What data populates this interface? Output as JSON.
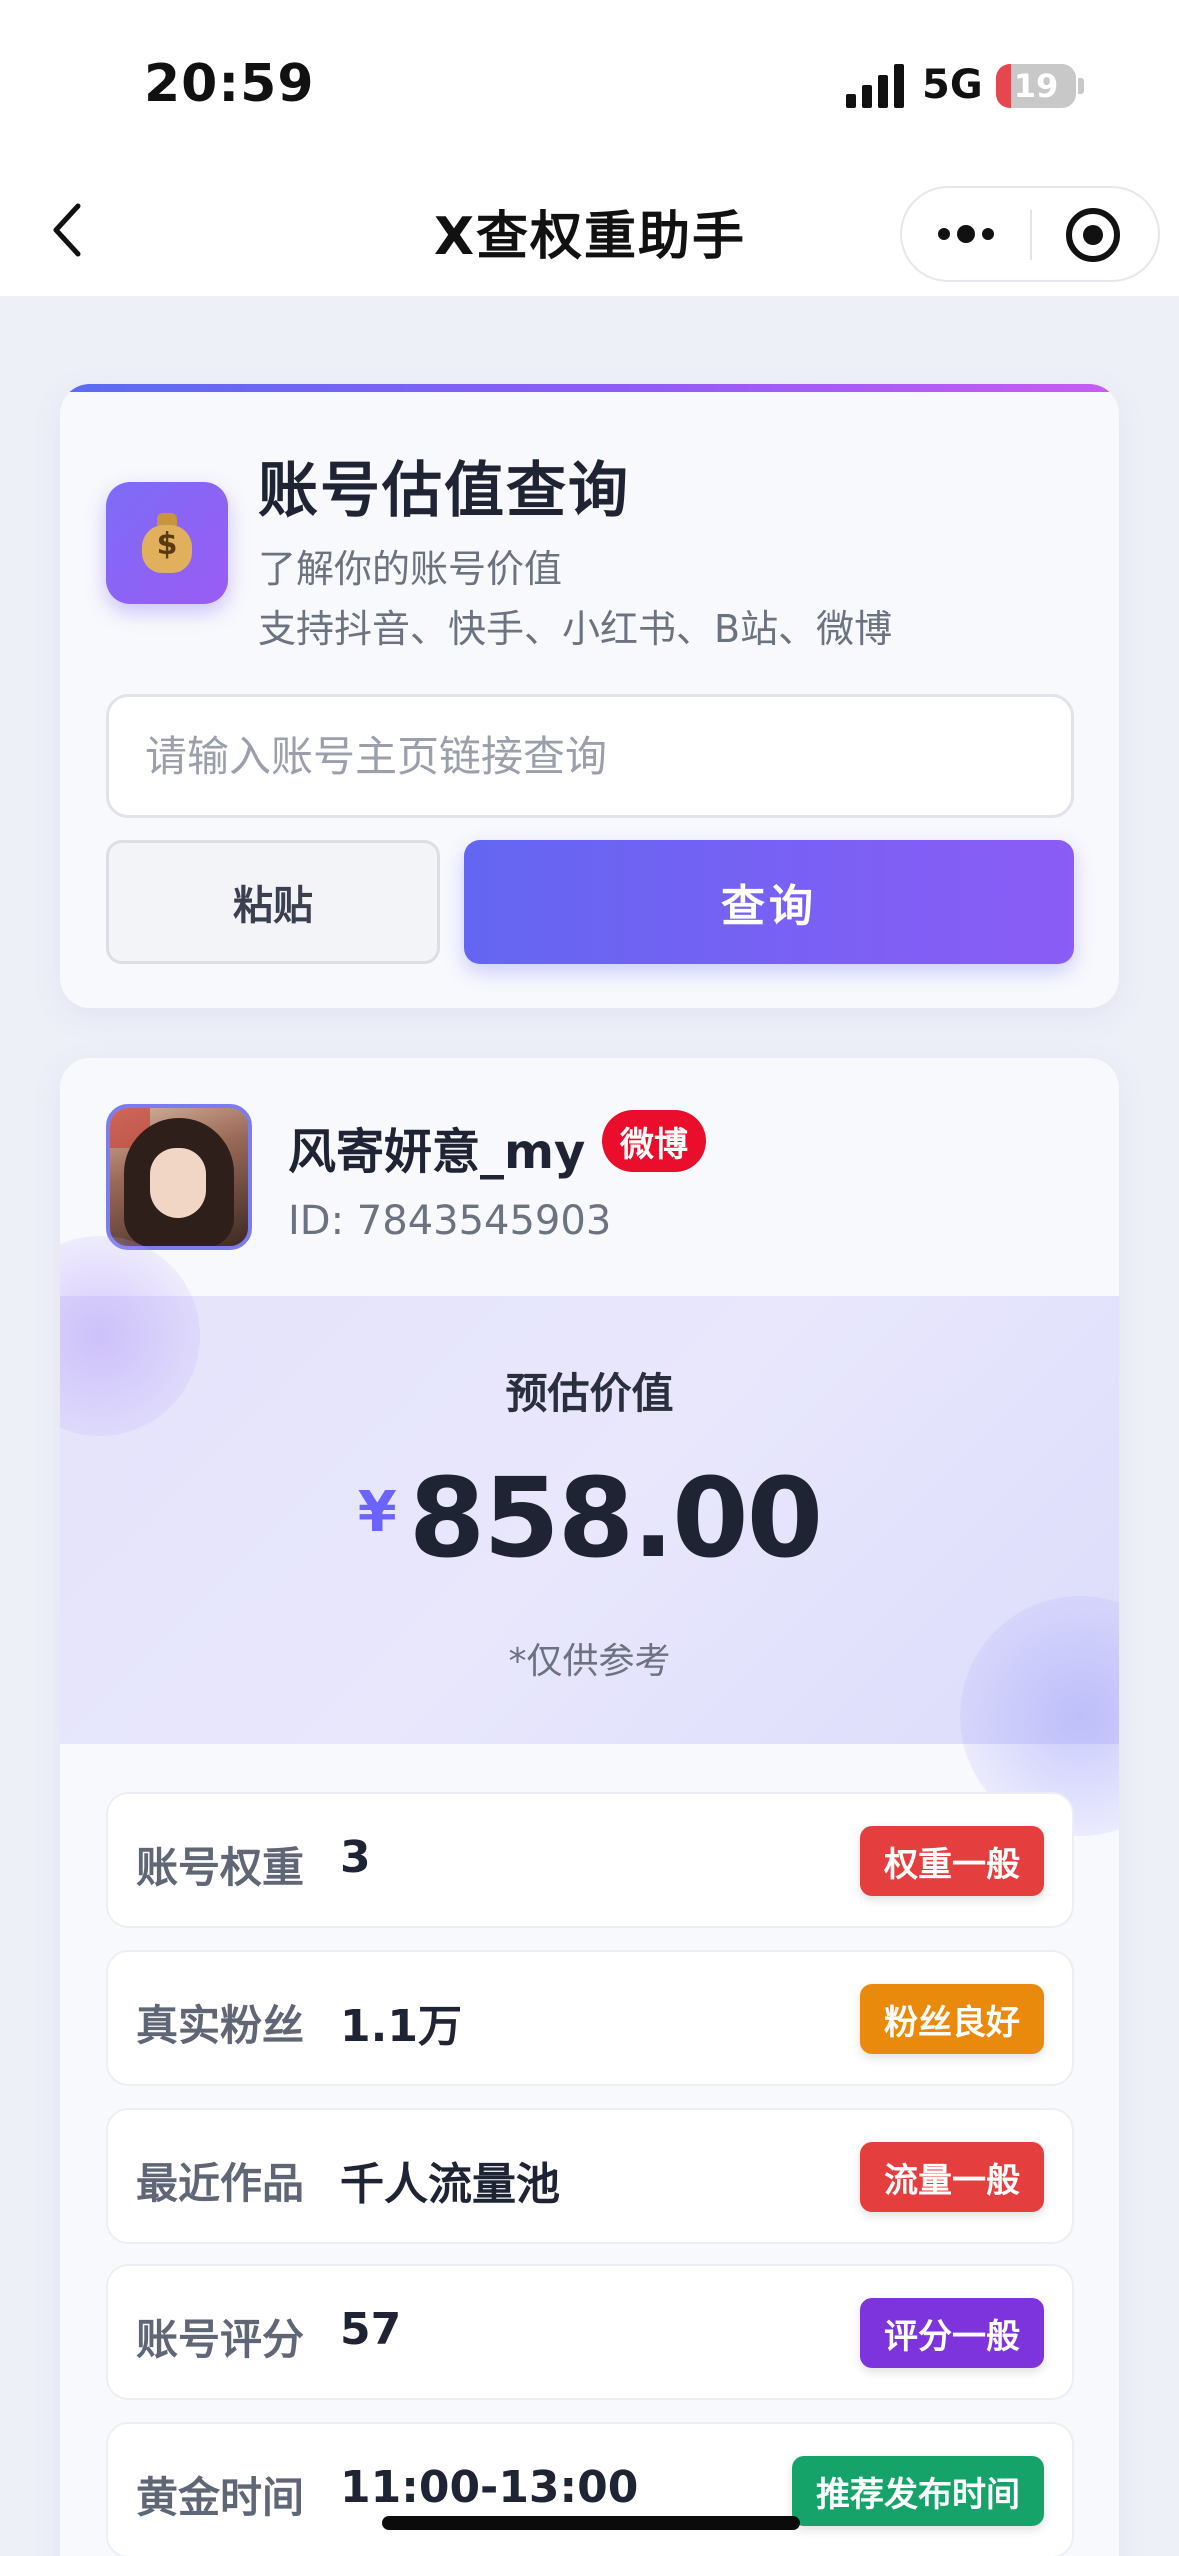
{
  "status_bar": {
    "time": "20:59",
    "network": "5G",
    "battery_level": "19",
    "battery_percent": 19,
    "battery_color": "#e5474f"
  },
  "nav": {
    "back_icon": "chevron-left-icon",
    "title": "X查权重助手",
    "more_icon": "more-dots-icon",
    "close_icon": "miniapp-close-icon"
  },
  "query_card": {
    "icon": "money-bag-icon",
    "title": "账号估值查询",
    "subtitle_line1": "了解你的账号价值",
    "subtitle_line2": "支持抖音、快手、小红书、B站、微博",
    "input_placeholder": "请输入账号主页链接查询",
    "input_value": "",
    "paste_button": "粘贴",
    "query_button": "查询",
    "accent_gradient": [
      "#6366f1",
      "#8b5cf6"
    ]
  },
  "account": {
    "name": "风寄妍意_my",
    "platform": "微博",
    "platform_color": "#ea0d2c",
    "id_text": "ID: 7843545903"
  },
  "valuation": {
    "label": "预估价值",
    "currency": "¥",
    "value": "858.00",
    "note": "*仅供参考"
  },
  "stats": [
    {
      "label": "账号权重",
      "value": "3",
      "tag": "权重一般",
      "tag_color": "#e53e3e"
    },
    {
      "label": "真实粉丝",
      "value": "1.1万",
      "tag": "粉丝良好",
      "tag_color": "#ea8a0c"
    },
    {
      "label": "最近作品",
      "value": "千人流量池",
      "tag": "流量一般",
      "tag_color": "#e53e3e"
    },
    {
      "label": "账号评分",
      "value": "57",
      "tag": "评分一般",
      "tag_color": "#7e34dc"
    },
    {
      "label": "黄金时间",
      "value": "11:00-13:00",
      "tag": "推荐发布时间",
      "tag_color": "#16a36a"
    }
  ]
}
